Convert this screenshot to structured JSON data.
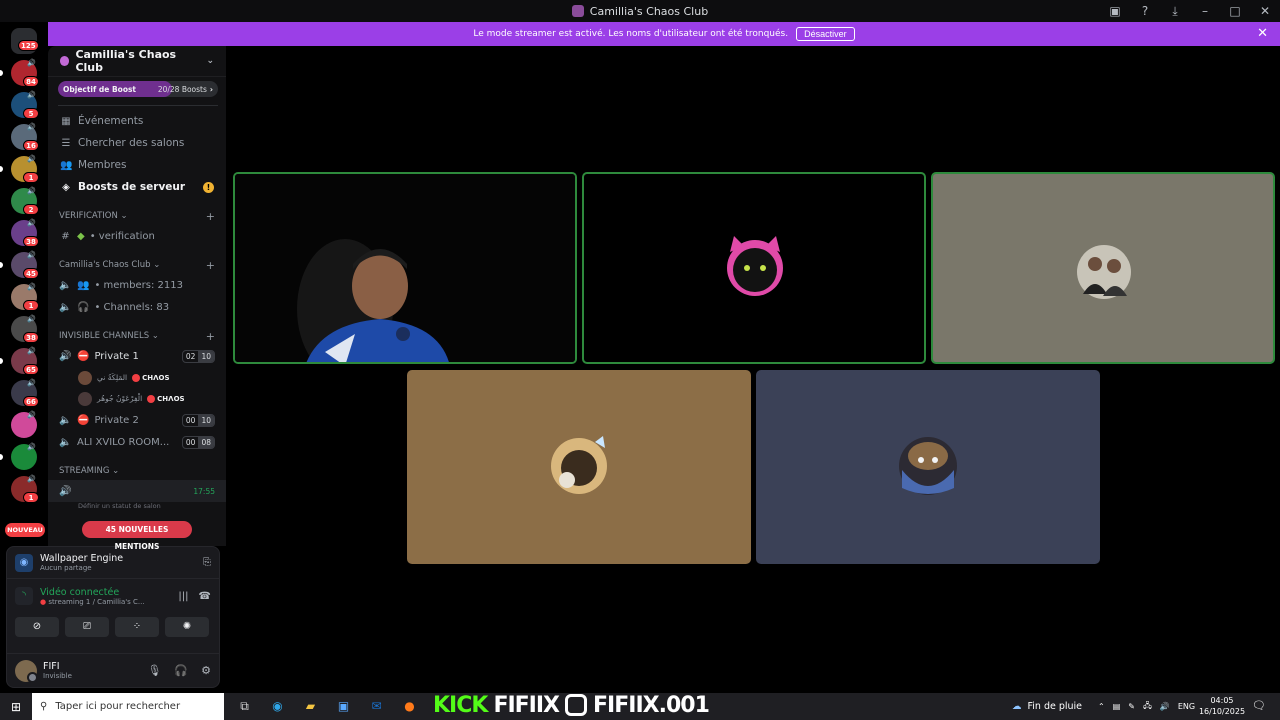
{
  "window": {
    "title": "Camillia's Chaos Club",
    "actions": [
      "inbox-icon",
      "help-icon",
      "download-icon",
      "minimize",
      "maximize",
      "close"
    ]
  },
  "banner": {
    "text": "Le mode streamer est activé. Les noms d'utilisateur ont été tronqués.",
    "button": "Désactiver"
  },
  "rail": {
    "home_badge": "125",
    "new_label": "NOUVEAU",
    "servers": [
      {
        "badge": "84",
        "color": "#b0262f"
      },
      {
        "badge": "5",
        "color": "#1c4f7a"
      },
      {
        "badge": "16",
        "color": "#5a6a7a"
      },
      {
        "badge": "1",
        "color": "#b8902f"
      },
      {
        "badge": "2",
        "color": "#2f8a4a"
      },
      {
        "badge": "38",
        "color": "#6a3f8a"
      },
      {
        "badge": "45",
        "color": "#5a4a6a"
      },
      {
        "badge": "1",
        "color": "#9a7a6a"
      },
      {
        "badge": "38",
        "color": "#4a4a4a"
      },
      {
        "badge": "65",
        "color": "#7a3a4a"
      },
      {
        "badge": "66",
        "color": "#3a3a4a"
      },
      {
        "badge": "",
        "color": "#d04a9a"
      },
      {
        "badge": "",
        "color": "#1a8a3a"
      },
      {
        "badge": "1",
        "color": "#8a2a2a"
      }
    ]
  },
  "sidebar": {
    "server_name": "Camillia's Chaos Club",
    "boost": {
      "label": "Objectif de Boost",
      "count": "20/28 Boosts",
      "progress": 0.714
    },
    "nav": [
      {
        "label": "Événements",
        "icon": "calendar-icon"
      },
      {
        "label": "Chercher des salons",
        "icon": "channels-icon"
      },
      {
        "label": "Membres",
        "icon": "members-icon"
      },
      {
        "label": "Boosts de serveur",
        "icon": "boost-icon"
      }
    ],
    "categories": {
      "verification": "VERIFICATION",
      "club": "Camillia's Chaos Club",
      "invisible": "INVISIBLE CHANNELS",
      "streaming": "STREAMING"
    },
    "channels": {
      "verification": "verification",
      "members": "members: 2113",
      "channels": "Channels: 83",
      "private1": "Private 1",
      "private1_pills": [
        "02",
        "10"
      ],
      "private2": "Private 2",
      "private2_pills": [
        "00",
        "10"
      ],
      "ali": "ALI XVILO ROOM...",
      "ali_pills": [
        "00",
        "08"
      ],
      "voice_users": [
        {
          "name": "المَلِكَةُ ني",
          "tag": "CHΛOS"
        },
        {
          "name": "الْفِرْعَوْنُ جُوهُر",
          "tag": "CHΛOS"
        }
      ],
      "streaming_time": "17:55",
      "status_hint": "Définir un statut de salon"
    },
    "mentions": "45 NOUVELLES MENTIONS"
  },
  "panel": {
    "activity_title": "Wallpaper Engine",
    "activity_sub": "Aucun partage",
    "voice_status": "Vidéo connectée",
    "voice_channel": "streaming 1 / Camillia's C...",
    "user_name": "FIFI",
    "user_status": "Invisible"
  },
  "taskbar": {
    "search_placeholder": "Taper ici pour rechercher",
    "overlay_kick": "KICK",
    "overlay_name1": "FIFIIX",
    "overlay_name2": "FIFIIX.001",
    "weather": "Fin de pluie",
    "lang": "ENG",
    "time": "04:05",
    "date": "16/10/2025"
  }
}
